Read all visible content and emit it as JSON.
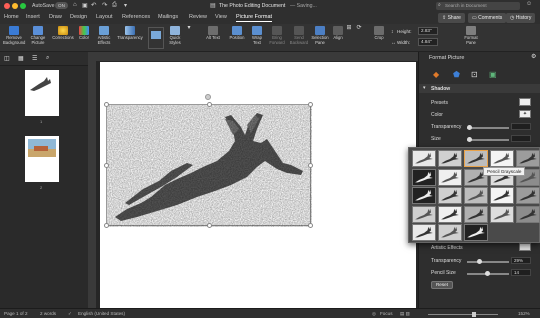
{
  "titlebar": {
    "autosave_label": "AutoSave",
    "autosave_state": "ON",
    "document_title": "The Photo Editing Document",
    "status": "— Saving...",
    "search_placeholder": "Search in Document"
  },
  "ribbon_tabs": [
    "Home",
    "Insert",
    "Draw",
    "Design",
    "Layout",
    "References",
    "Mailings",
    "Review",
    "View",
    "Picture Format"
  ],
  "active_tab": "Picture Format",
  "share": {
    "share_label": "Share",
    "comments_label": "Comments",
    "history_label": "History"
  },
  "ribbon": {
    "remove_background": "Remove Background",
    "change_picture": "Change Picture",
    "corrections": "Corrections",
    "color": "Color",
    "artistic_effects": "Artistic Effects",
    "transparency": "Transparency",
    "quick_styles": "Quick Styles",
    "alt_text": "Alt Text",
    "position": "Position",
    "wrap_text": "Wrap Text",
    "bring_forward": "Bring Forward",
    "send_backward": "Send Backward",
    "selection_pane": "Selection Pane",
    "align": "Align",
    "crop": "Crop",
    "height_label": "Height:",
    "height_value": "2.83\"",
    "width_label": "Width:",
    "width_value": "4.84\"",
    "format_pane": "Format Pane"
  },
  "thumbnails": {
    "pages": [
      "1",
      "2"
    ]
  },
  "panel": {
    "title": "Format Picture",
    "section": "Shadow",
    "presets_label": "Presets",
    "color_label": "Color",
    "transparency_label": "Transparency",
    "size_label": "Size",
    "artistic_label": "Artistic Effects",
    "transparency2_label": "Transparency",
    "transparency2_value": "29%",
    "transparency2_level": 0.29,
    "pencil_label": "Pencil Size",
    "pencil_value": "14",
    "reset_label": "Reset"
  },
  "tooltip": "Pencil Grayscale",
  "status": {
    "page": "Page 1 of 2",
    "words": "2 words",
    "language": "English (United States)",
    "focus": "Focus",
    "zoom": "152%"
  },
  "colors": {
    "accent": "#2f7ad8",
    "gallery_selected": "#e8a24a"
  }
}
